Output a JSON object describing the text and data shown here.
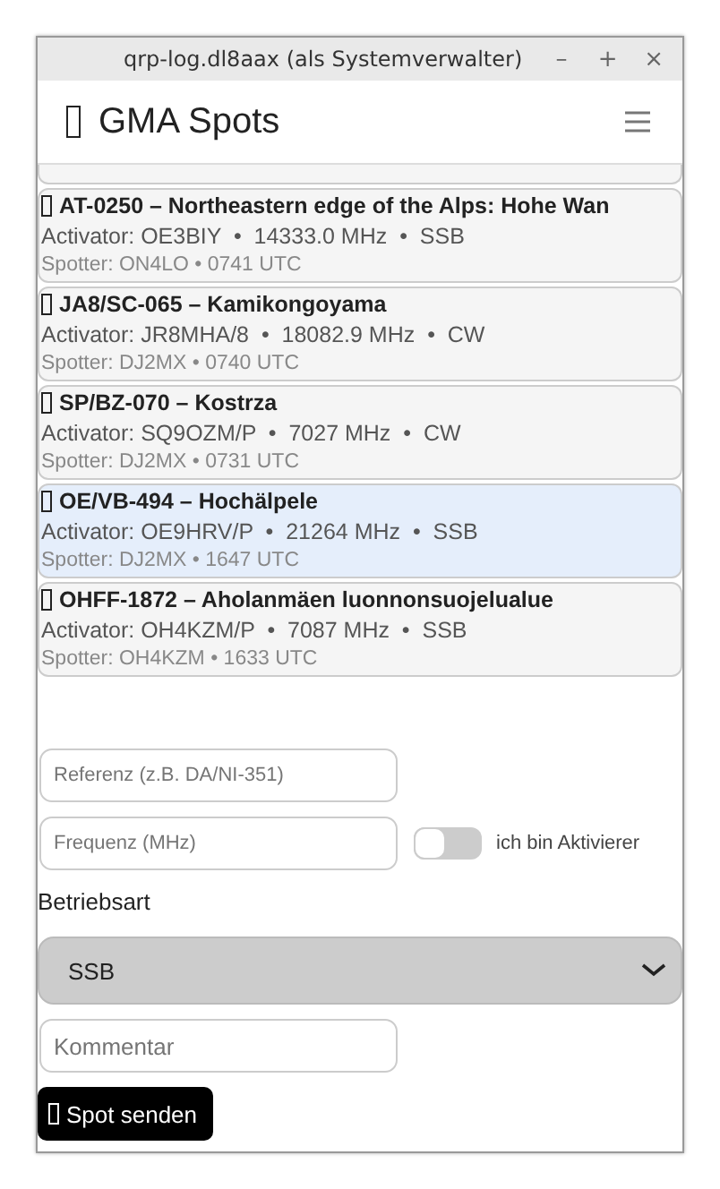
{
  "window": {
    "title": "qrp-log.dl8aax (als Systemverwalter)",
    "controls": [
      "–",
      "+",
      "×"
    ]
  },
  "header": {
    "title": "GMA Spots"
  },
  "spots": [
    {
      "reference": "AT-0250 – Northeastern edge of the Alps: Hohe Wan",
      "activator": "Activator: OE3BIY  •  14333.0 MHz  •  SSB",
      "spotter": "Spotter: ON4LO • 0741 UTC",
      "selected": false
    },
    {
      "reference": "JA8/SC-065 – Kamikongoyama",
      "activator": "Activator: JR8MHA/8  •  18082.9 MHz  •  CW",
      "spotter": "Spotter: DJ2MX • 0740 UTC",
      "selected": false
    },
    {
      "reference": "SP/BZ-070 – Kostrza",
      "activator": "Activator: SQ9OZM/P  •  7027 MHz  •  CW",
      "spotter": "Spotter: DJ2MX • 0731 UTC",
      "selected": false
    },
    {
      "reference": "OE/VB-494 – Hochälpele",
      "activator": "Activator: OE9HRV/P  •  21264 MHz  •  SSB",
      "spotter": "Spotter: DJ2MX • 1647 UTC",
      "selected": true
    },
    {
      "reference": "OHFF-1872 – Aholanmäen luonnonsuojelualue",
      "activator": "Activator: OH4KZM/P  •  7087 MHz  •  SSB",
      "spotter": "Spotter: OH4KZM • 1633 UTC",
      "selected": false
    }
  ],
  "form": {
    "reference": {
      "placeholder": "Referenz (z.B. DA/NI-351)"
    },
    "frequency": {
      "placeholder": "Frequenz (MHz)"
    },
    "activator_toggle": {
      "label": "ich bin Aktivierer",
      "on": false
    },
    "mode_label": "Betriebsart",
    "mode": {
      "value": "SSB"
    },
    "comment": {
      "placeholder": "Kommentar"
    },
    "submit": "Spot senden"
  }
}
